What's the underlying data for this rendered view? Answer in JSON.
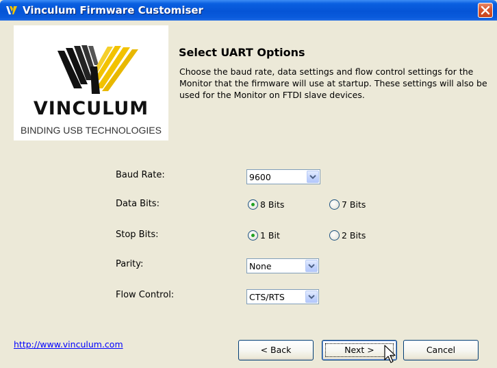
{
  "window": {
    "title": "Vinculum Firmware Customiser",
    "icon": "vinculum-app-icon",
    "close_icon": "close-icon"
  },
  "logo": {
    "word": "VINCULUM",
    "tagline": "BINDING USB TECHNOLOGIES"
  },
  "page": {
    "heading": "Select UART Options",
    "description": "Choose the baud rate, data settings and flow control settings for the Monitor that the firmware will use at startup. These settings will also be used for the Monitor on FTDI slave devices."
  },
  "form": {
    "baud_rate": {
      "label": "Baud Rate:",
      "value": "9600"
    },
    "data_bits": {
      "label": "Data Bits:",
      "option_a": "8 Bits",
      "option_b": "7 Bits",
      "selected": "8 Bits"
    },
    "stop_bits": {
      "label": "Stop Bits:",
      "option_a": "1 Bit",
      "option_b": "2 Bits",
      "selected": "1 Bit"
    },
    "parity": {
      "label": "Parity:",
      "value": "None"
    },
    "flow_control": {
      "label": "Flow Control:",
      "value": "CTS/RTS"
    }
  },
  "footer": {
    "link": "http://www.vinculum.com",
    "back_label": "< Back",
    "next_label": "Next >",
    "cancel_label": "Cancel"
  },
  "colors": {
    "titlebar": "#0554d6",
    "window_bg": "#ece9d8",
    "link": "#0000ff",
    "radio_selected": "#21a121",
    "logo_yellow": "#f2c200"
  }
}
